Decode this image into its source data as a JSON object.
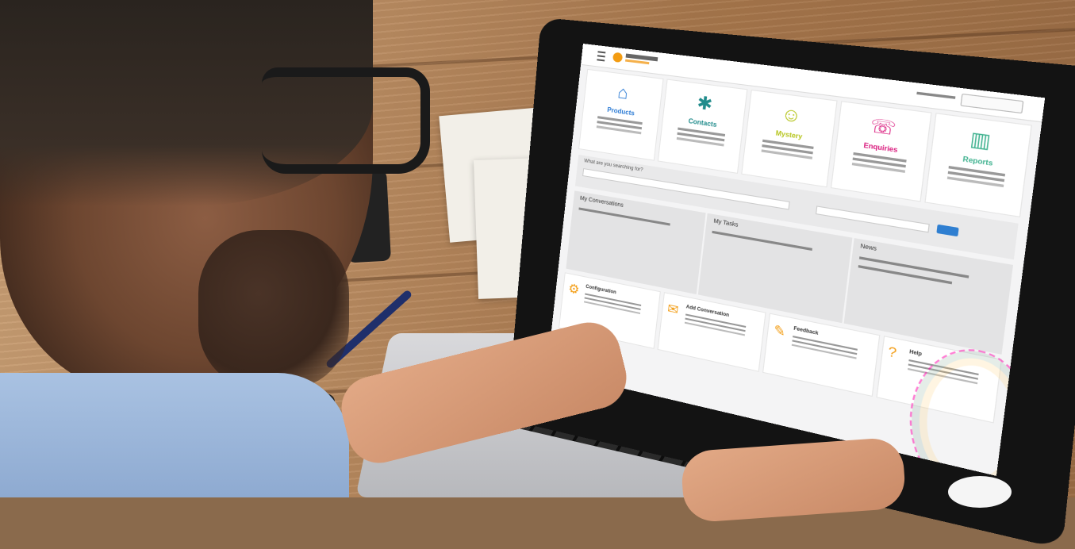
{
  "app": {
    "tiles": [
      {
        "label": "Products",
        "icon": "home-icon",
        "glyph": "⌂",
        "color": "#2a7ad4"
      },
      {
        "label": "Contacts",
        "icon": "people-icon",
        "glyph": "✱",
        "color": "#1f8b8b"
      },
      {
        "label": "Mystery",
        "icon": "person-icon",
        "glyph": "☺",
        "color": "#b5c41a"
      },
      {
        "label": "Enquiries",
        "icon": "phone-icon",
        "glyph": "☏",
        "color": "#d9187c"
      },
      {
        "label": "Reports",
        "icon": "bar-chart-icon",
        "glyph": "▥",
        "color": "#3db18e"
      }
    ],
    "search": {
      "question": "What are you searching for?"
    },
    "panels": [
      {
        "title": "My Conversations"
      },
      {
        "title": "My Tasks"
      },
      {
        "title": "News"
      }
    ],
    "bottom_tiles": [
      {
        "label": "Configuration",
        "icon": "gear-icon",
        "glyph": "⚙",
        "color": "#f39c12"
      },
      {
        "label": "Add Conversation",
        "icon": "chat-icon",
        "glyph": "✉",
        "color": "#f39c12"
      },
      {
        "label": "Feedback",
        "icon": "edit-icon",
        "glyph": "✎",
        "color": "#f39c12"
      },
      {
        "label": "Help",
        "icon": "help-icon",
        "glyph": "?",
        "color": "#f39c12"
      }
    ]
  }
}
